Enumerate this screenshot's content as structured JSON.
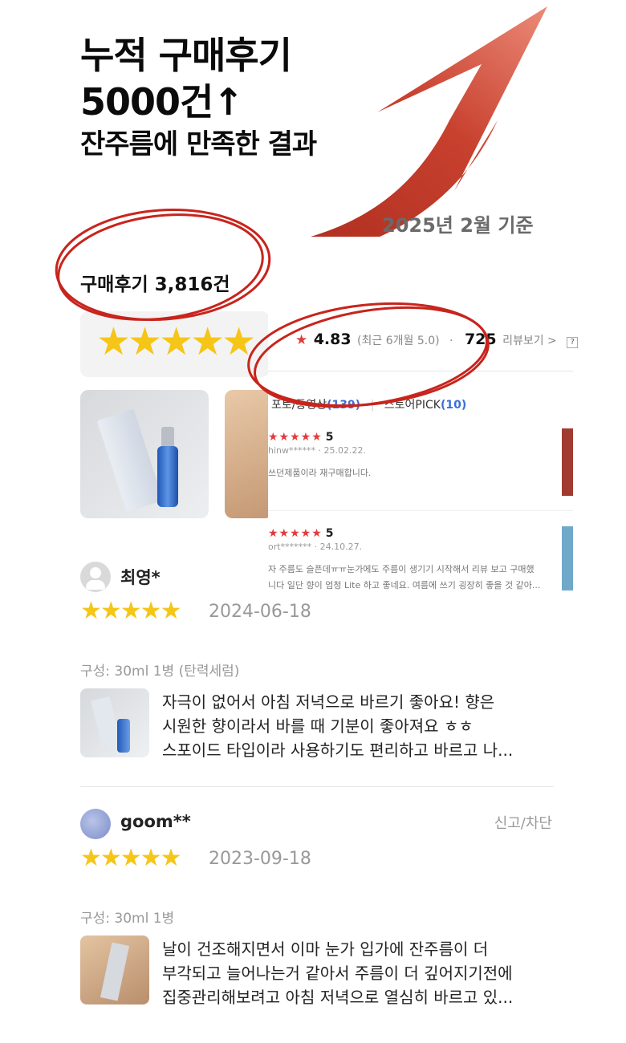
{
  "headline": {
    "line1": "누적 구매후기",
    "line2": "5000건↑",
    "line3": "잔주름에 만족한 결과"
  },
  "as_of": "2025년 2월 기준",
  "review_count_label": "구매후기 3,816건",
  "summary_stars": "★★★★★",
  "overlay": {
    "star": "★",
    "rating": "4.83",
    "recent_note": "(최근 6개월 5.0)",
    "dot": "·",
    "review_count": "725",
    "review_label": "리뷰보기 >",
    "help": "?",
    "tab_photo": "포토/동영상",
    "tab_photo_count": "(139)",
    "tab_store": "스토어PICK",
    "tab_store_count": "(10)",
    "reviews": [
      {
        "stars": "★★★★★",
        "score": "5",
        "user": "hinw******",
        "date": "25.02.22.",
        "body": "쓰던제품이라 재구매합니다."
      },
      {
        "stars": "★★★★★",
        "score": "5",
        "user": "ort*******",
        "date": "24.10.27.",
        "body_line1": "자 주름도 슬픈데ㅠㅠ눈가에도 주름이 생기기 시작해서 리뷰 보고 구매했",
        "body_line2": "니다 일단 향이 엄청 Lite 하고 좋네요. 여름에 쓰기 굉장히 좋을 것 같아..."
      }
    ]
  },
  "reviews": [
    {
      "name": "최영*",
      "stars": "★★★★★",
      "date": "2024-06-18",
      "option": "구성: 30ml 1병 (탄력세럼)",
      "lines": [
        "자극이 없어서 아침 저녁으로 바르기 좋아요! 향은",
        "시원한 향이라서 바를 때 기분이 좋아져요 ㅎㅎ",
        "스포이드 타입이라 사용하기도 편리하고 바르고 나..."
      ]
    },
    {
      "name": "goom**",
      "report": "신고/차단",
      "stars": "★★★★★",
      "date": "2023-09-18",
      "option": "구성: 30ml 1병",
      "lines": [
        "날이 건조해지면서 이마 눈가 입가에 잔주름이 더",
        "부각되고 늘어나는거 같아서 주름이 더 깊어지기전에",
        "집중관리해보려고 아침 저녁으로 열심히 바르고 있..."
      ]
    }
  ],
  "colors": {
    "star_yellow": "#f5c518",
    "star_red": "#e23b3b",
    "arrow_red": "#c8402e",
    "circle_red": "#c8241c",
    "link_blue": "#3a6fd6"
  }
}
